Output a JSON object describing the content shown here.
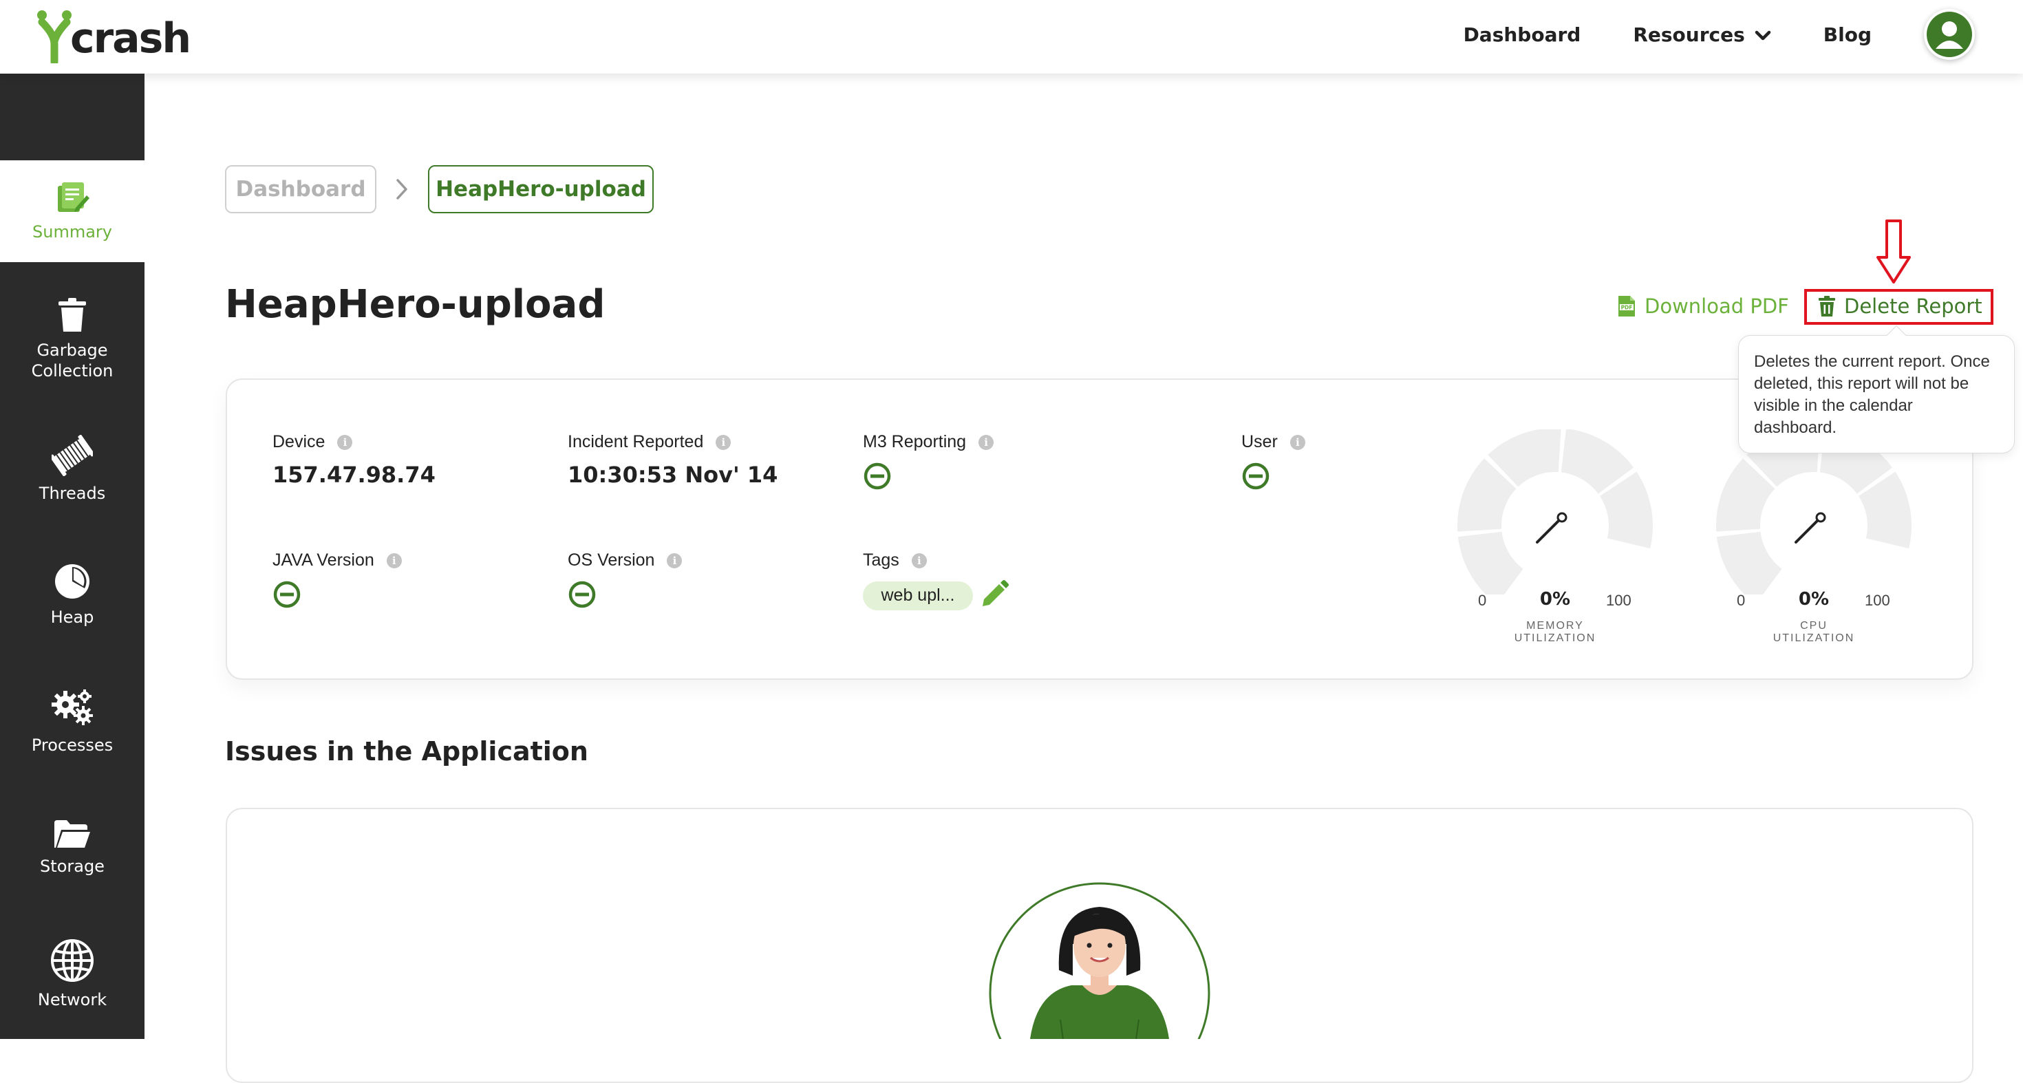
{
  "topbar": {
    "logo_text": "crash",
    "nav": {
      "dashboard": "Dashboard",
      "resources": "Resources",
      "blog": "Blog"
    }
  },
  "sidebar": {
    "items": [
      {
        "label": "Summary",
        "icon": "summary-icon",
        "active": true
      },
      {
        "label": "Garbage Collection",
        "icon": "trash-can-icon",
        "active": false
      },
      {
        "label": "Threads",
        "icon": "thread-spool-icon",
        "active": false
      },
      {
        "label": "Heap",
        "icon": "pie-chart-icon",
        "active": false
      },
      {
        "label": "Processes",
        "icon": "gears-icon",
        "active": false
      },
      {
        "label": "Storage",
        "icon": "folder-icon",
        "active": false
      },
      {
        "label": "Network",
        "icon": "globe-icon",
        "active": false
      }
    ]
  },
  "breadcrumb": {
    "dashboard": "Dashboard",
    "current": "HeapHero-upload"
  },
  "page": {
    "title": "HeapHero-upload",
    "download_pdf": "Download PDF",
    "delete_report": "Delete Report",
    "tooltip": "Deletes the current report. Once deleted, this report will not be visible in the calendar dashboard."
  },
  "summary": {
    "device_label": "Device",
    "device_value": "157.47.98.74",
    "incident_label": "Incident Reported",
    "incident_value": "10:30:53 Nov' 14",
    "m3_label": "M3 Reporting",
    "user_label": "User",
    "java_label": "JAVA Version",
    "os_label": "OS Version",
    "tags_label": "Tags",
    "tag_value": "web upl..."
  },
  "gauges": [
    {
      "percent": 0,
      "percent_text": "0%",
      "min": "0",
      "max": "100",
      "caption_1": "MEMORY",
      "caption_2": "UTILIZATION"
    },
    {
      "percent": 0,
      "percent_text": "0%",
      "min": "0",
      "max": "100",
      "caption_1": "CPU",
      "caption_2": "UTILIZATION"
    }
  ],
  "issues": {
    "title": "Issues in the Application"
  },
  "colors": {
    "brand_green": "#6bb13a",
    "dark_green": "#3e7a28",
    "sidebar_bg": "#2b2b2b",
    "highlight_red": "#e0141e"
  }
}
